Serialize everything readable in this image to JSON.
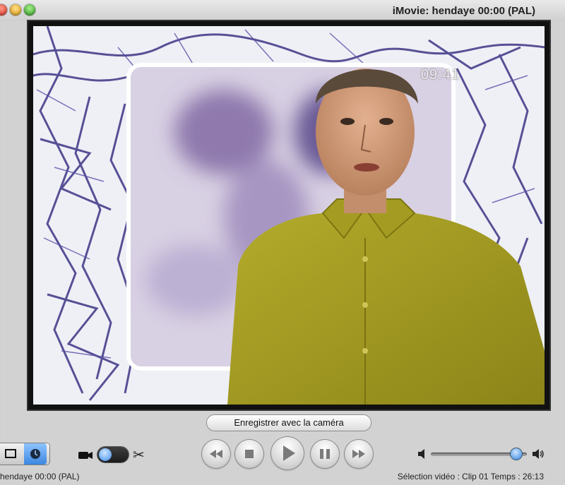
{
  "window": {
    "title": "iMovie: hendaye  00:00 (PAL)"
  },
  "monitor": {
    "timecode_overlay": "09:41"
  },
  "record_button": {
    "label": "Enregistrer avec la caméra"
  },
  "controls": {
    "view_mode": "time",
    "mode_switch": "camera",
    "volume_level": 0.94,
    "icons": [
      "clip-view-icon",
      "timeline-view-icon",
      "camera-icon",
      "scissors-icon",
      "rewind-icon",
      "stop-icon",
      "play-icon",
      "pause-icon",
      "fast-forward-icon",
      "volume-low-icon",
      "volume-high-icon"
    ]
  },
  "status": {
    "project": "hendaye  00:00 (PAL)",
    "selection": "Sélection vidéo : Clip 01 Temps : 26:13"
  },
  "colors": {
    "accent_blue": "#3b87e0",
    "close": "#d12b1c",
    "minimize": "#d9950b",
    "zoom": "#2f9d1f"
  }
}
